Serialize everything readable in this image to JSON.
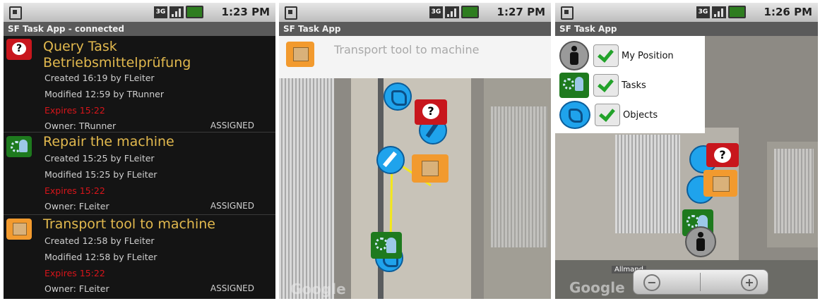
{
  "status": {
    "time1": "1:23 PM",
    "time2": "1:27 PM",
    "time3": "1:26 PM",
    "network": "3G"
  },
  "screen1": {
    "title": "SF Task App - connected",
    "tasks": [
      {
        "title": "Query Task",
        "title2": "Betriebsmittelprüfung",
        "created": "Created 16:19 by FLeiter",
        "modified": "Modified 12:59 by TRunner",
        "expires": "Expires 15:22",
        "owner": "Owner: TRunner",
        "status": "ASSIGNED"
      },
      {
        "title": "Repair the machine",
        "created": "Created 15:25 by FLeiter",
        "modified": "Modified 15:25 by FLeiter",
        "expires": "Expires 15:22",
        "owner": "Owner: FLeiter",
        "status": "ASSIGNED"
      },
      {
        "title": "Transport tool to machine",
        "created": "Created 12:58 by FLeiter",
        "modified": "Modified 12:58 by FLeiter",
        "expires": "Expires 15:22",
        "owner": "Owner: FLeiter",
        "status": "ASSIGNED"
      }
    ]
  },
  "screen2": {
    "title": "SF Task App",
    "task_title": "Transport tool to machine",
    "map_credit": "Google"
  },
  "screen3": {
    "title": "SF Task App",
    "layers": [
      "My Position",
      "Tasks",
      "Objects"
    ],
    "map_credit": "Google",
    "street": "Allmand"
  },
  "colors": {
    "query": "#c8161d",
    "repair": "#1e7a1e",
    "transport": "#f29a2e",
    "object": "#1fa3ec",
    "title_text": "#e2b94e",
    "expires": "#d7151a"
  },
  "icons": [
    "question-icon",
    "gear-person-icon",
    "package-icon",
    "wrench-icon",
    "hand-icon",
    "person-icon"
  ]
}
